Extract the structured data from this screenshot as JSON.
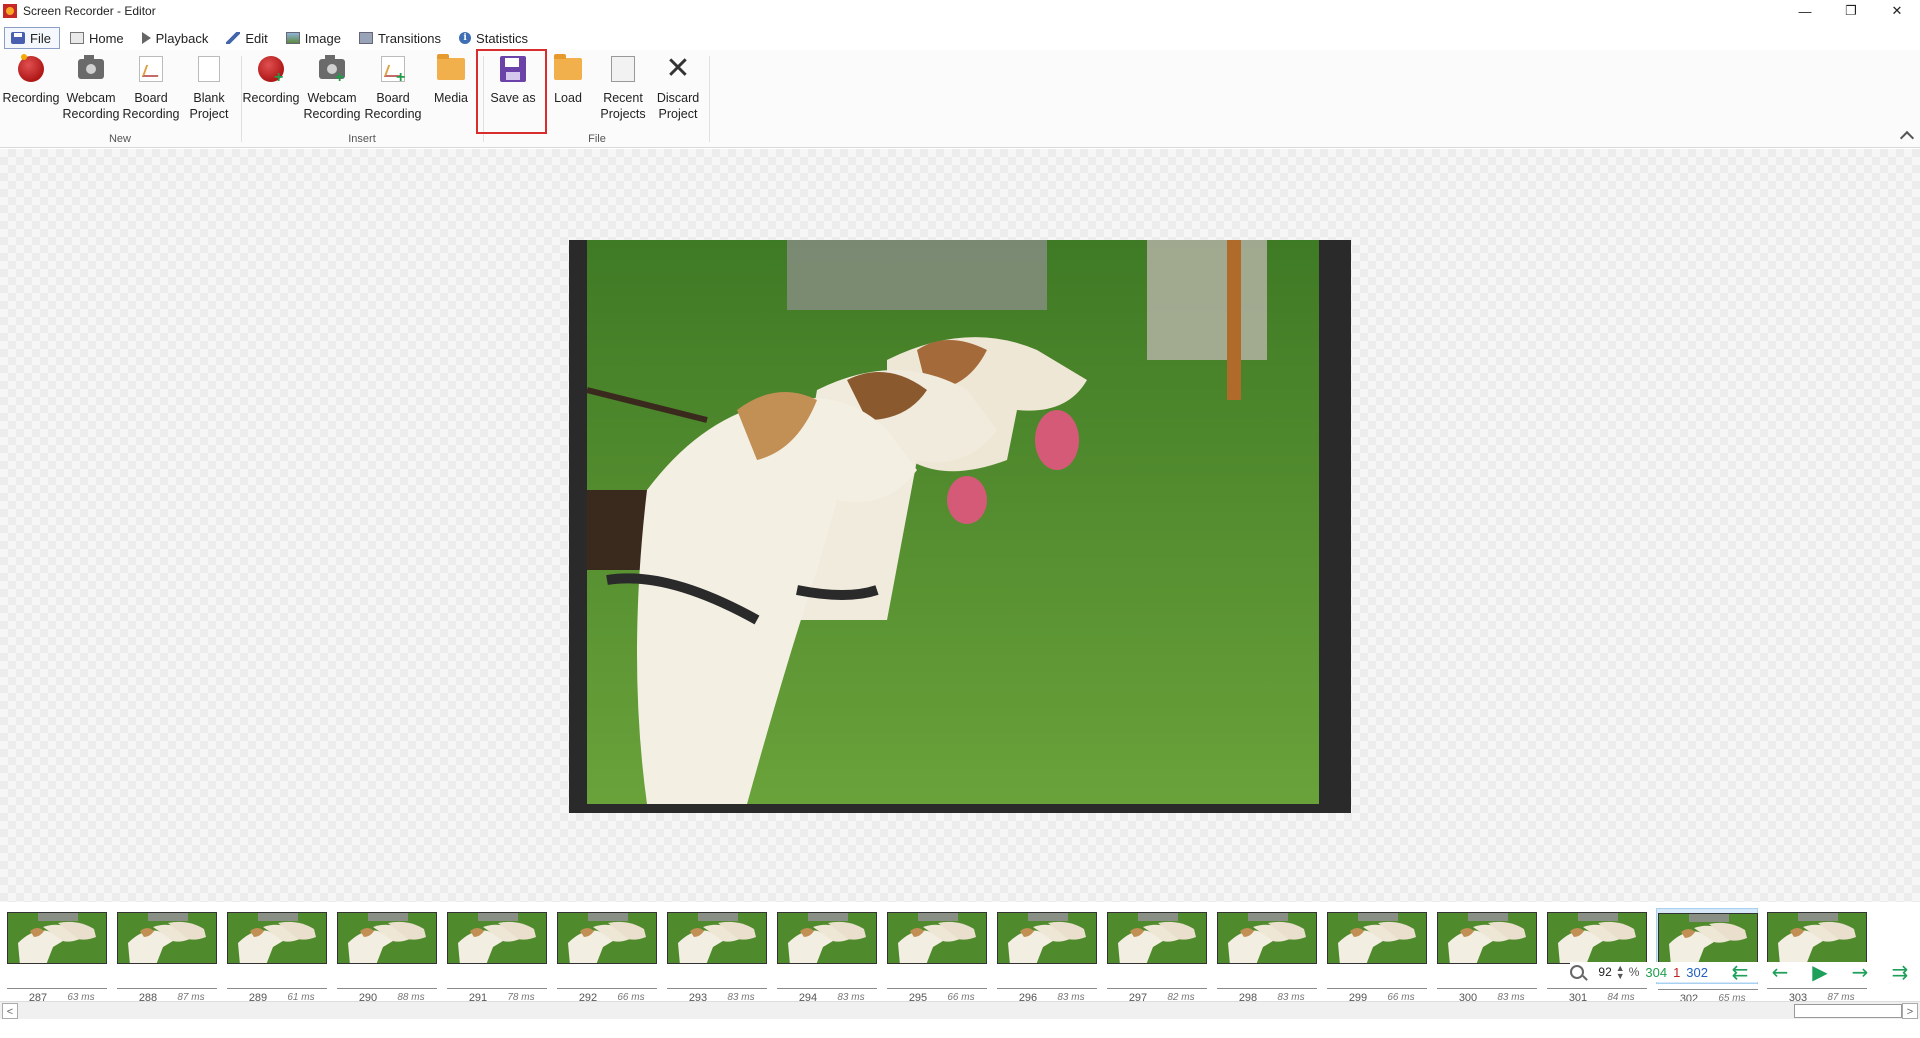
{
  "window": {
    "title": "Screen Recorder - Editor",
    "minimize": "—",
    "restore": "❐",
    "close": "✕"
  },
  "tabs": [
    {
      "label": "File",
      "icon": "save-icon",
      "active": true
    },
    {
      "label": "Home",
      "icon": "home-icon"
    },
    {
      "label": "Playback",
      "icon": "play-icon"
    },
    {
      "label": "Edit",
      "icon": "pencil-icon"
    },
    {
      "label": "Image",
      "icon": "image-icon"
    },
    {
      "label": "Transitions",
      "icon": "transitions-icon"
    },
    {
      "label": "Statistics",
      "icon": "info-icon"
    }
  ],
  "ribbon": {
    "groups": {
      "new": "New",
      "insert": "Insert",
      "file": "File"
    },
    "new_buttons": [
      {
        "label": "Recording",
        "icon": "record-icon"
      },
      {
        "label": "Webcam\nRecording",
        "icon": "webcam-icon"
      },
      {
        "label": "Board\nRecording",
        "icon": "board-icon"
      },
      {
        "label": "Blank\nProject",
        "icon": "blank-page-icon"
      }
    ],
    "insert_buttons": [
      {
        "label": "Recording",
        "icon": "record-add-icon"
      },
      {
        "label": "Webcam\nRecording",
        "icon": "webcam-add-icon"
      },
      {
        "label": "Board\nRecording",
        "icon": "board-add-icon"
      },
      {
        "label": "Media",
        "icon": "folder-icon"
      }
    ],
    "file_buttons": [
      {
        "label": "Save as",
        "icon": "save-icon",
        "highlighted": true
      },
      {
        "label": "Load",
        "icon": "folder-open-icon"
      },
      {
        "label": "Recent\nProjects",
        "icon": "recent-projects-icon"
      },
      {
        "label": "Discard\nProject",
        "icon": "discard-icon"
      }
    ]
  },
  "frames": [
    {
      "num": "287",
      "dur": "63 ms"
    },
    {
      "num": "288",
      "dur": "87 ms"
    },
    {
      "num": "289",
      "dur": "61 ms"
    },
    {
      "num": "290",
      "dur": "88 ms"
    },
    {
      "num": "291",
      "dur": "78 ms"
    },
    {
      "num": "292",
      "dur": "66 ms"
    },
    {
      "num": "293",
      "dur": "83 ms"
    },
    {
      "num": "294",
      "dur": "83 ms"
    },
    {
      "num": "295",
      "dur": "66 ms"
    },
    {
      "num": "296",
      "dur": "83 ms"
    },
    {
      "num": "297",
      "dur": "82 ms"
    },
    {
      "num": "298",
      "dur": "83 ms"
    },
    {
      "num": "299",
      "dur": "66 ms"
    },
    {
      "num": "300",
      "dur": "83 ms"
    },
    {
      "num": "301",
      "dur": "84 ms"
    },
    {
      "num": "302",
      "dur": "65 ms",
      "selected": true
    },
    {
      "num": "303",
      "dur": "87 ms"
    }
  ],
  "status": {
    "zoom": "92",
    "zoom_unit": "%",
    "total_frames": "304",
    "selected_count": "1",
    "current_frame": "302"
  },
  "nav": {
    "first": "⇇",
    "prev": "←",
    "play": "▶",
    "next": "→",
    "last": "⇉"
  },
  "colors": {
    "accent_highlight": "#d92d2d",
    "nav_green": "#1ea05a",
    "selected_frame": "#d7e9f9"
  }
}
